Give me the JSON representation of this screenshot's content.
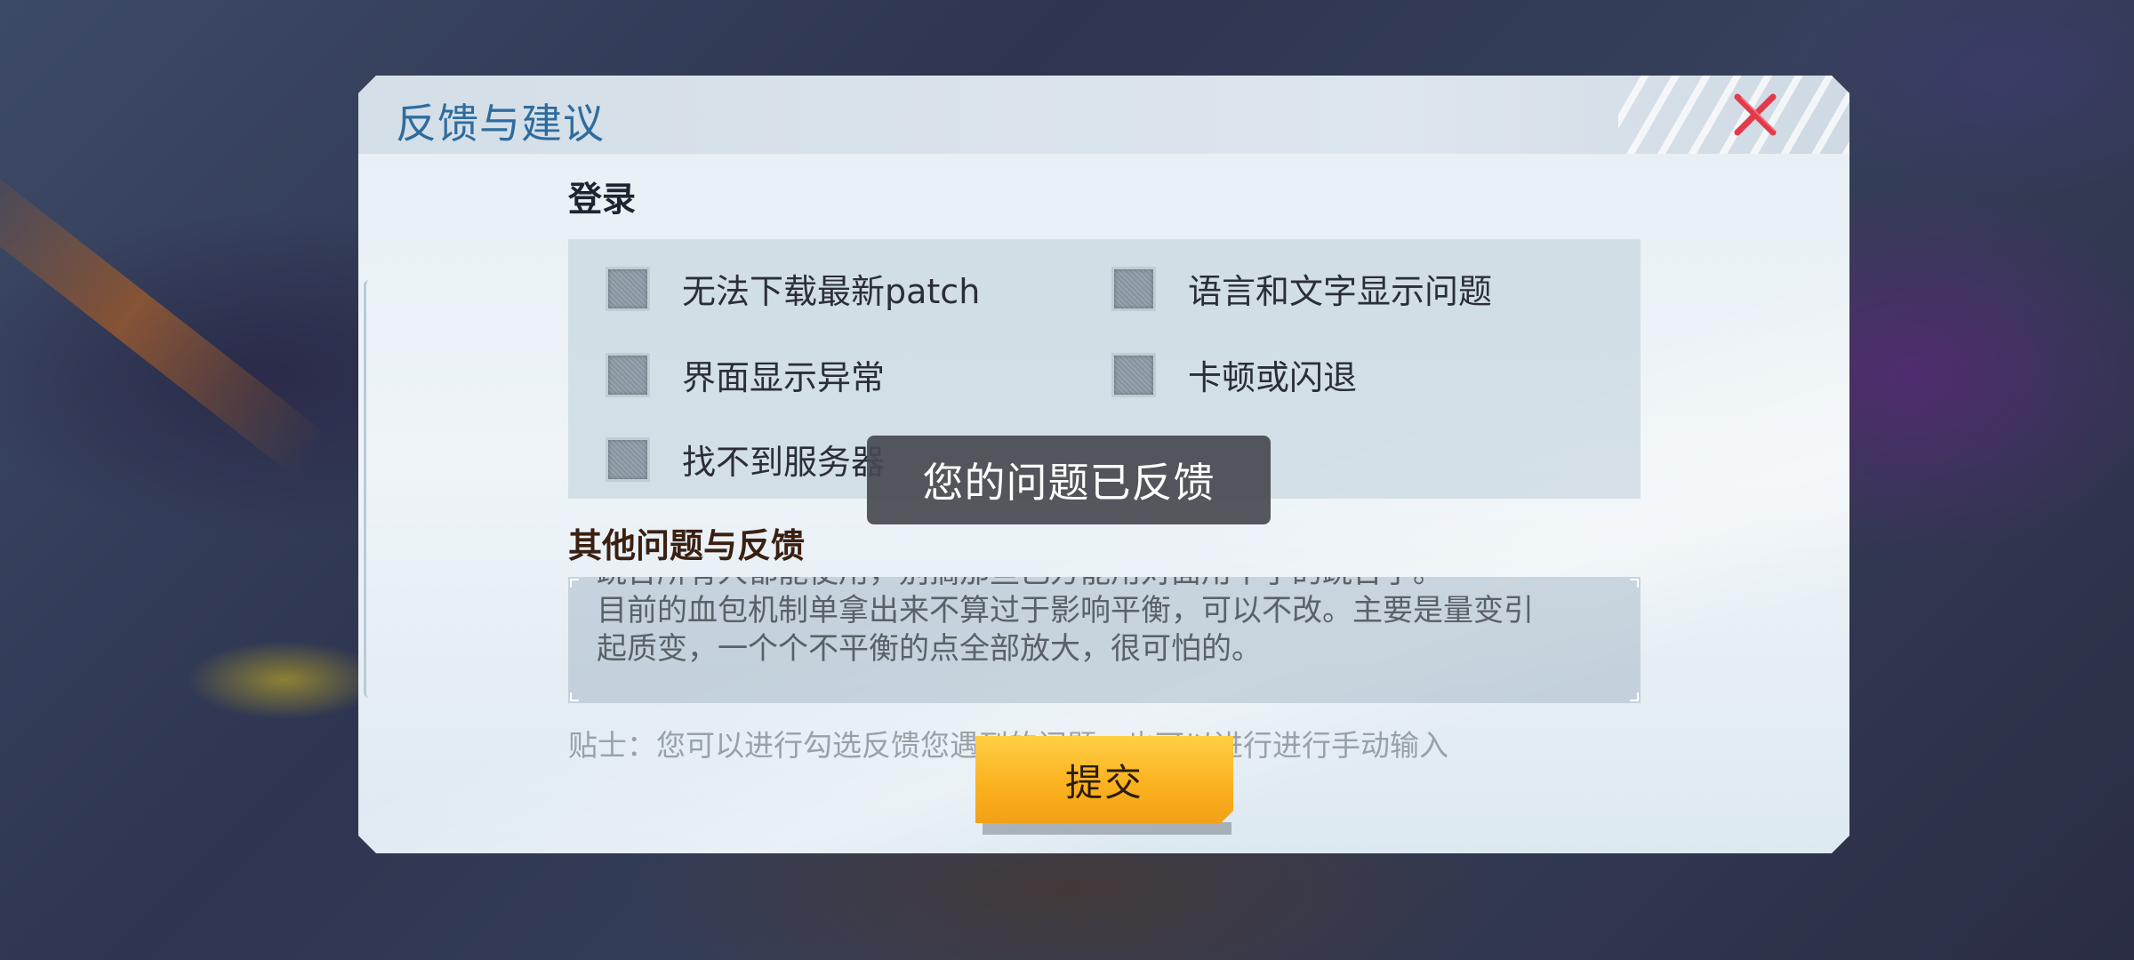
{
  "dialog": {
    "title": "反馈与建议",
    "close_icon": "close-x-icon",
    "close_color": "#e23a4a"
  },
  "login_section": {
    "title": "登录",
    "options": [
      {
        "label": "无法下载最新patch",
        "checked": false
      },
      {
        "label": "语言和文字显示问题",
        "checked": false
      },
      {
        "label": "界面显示异常",
        "checked": false
      },
      {
        "label": "卡顿或闪退",
        "checked": false
      },
      {
        "label": "找不到服务器",
        "checked": false
      }
    ]
  },
  "other_section": {
    "title": "其他问题与反馈",
    "text_lines": [
      "跳台所有人都能使用，别搞那些己方能用对面用不了的跳台了。",
      "目前的血包机制单拿出来不算过于影响平衡，可以不改。主要是量变引",
      "起质变，一个个不平衡的点全部放大，很可怕的。"
    ]
  },
  "tip": "贴士：您可以进行勾选反馈您遇到的问题，也可以进行进行手动输入",
  "submit_label": "提交",
  "submit_color": "#fbb220",
  "toast": "您的问题已反馈"
}
